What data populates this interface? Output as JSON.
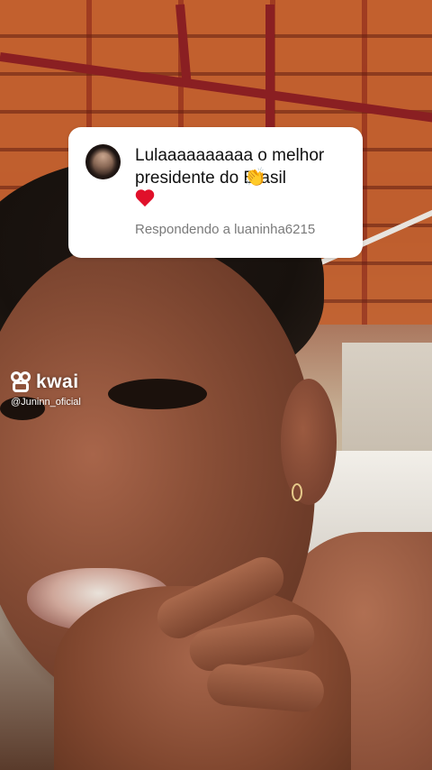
{
  "reply": {
    "comment_line1": "Lulaaaaaaaaaa o melhor",
    "comment_line2": "presidente do Brasil",
    "clap_emoji": "👏",
    "replying_to": "Respondendo a luaninha6215"
  },
  "watermark": {
    "brand": "kwai",
    "handle": "@Juninn_oficial"
  },
  "colors": {
    "heart": "#e0102a",
    "card_background": "#ffffff",
    "subtext": "#7a7a7a"
  }
}
